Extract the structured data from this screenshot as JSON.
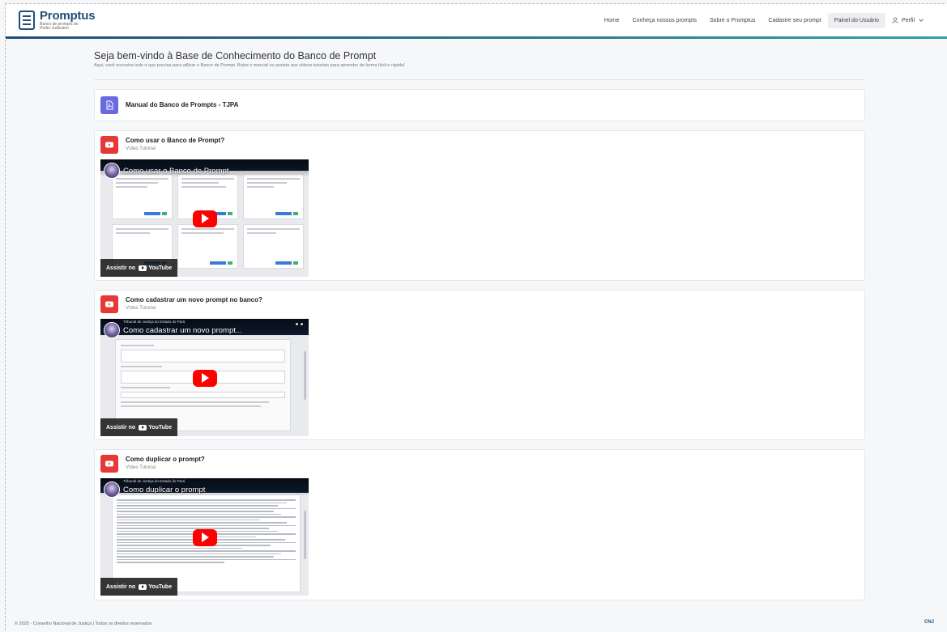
{
  "header": {
    "logo_title": "Promptus",
    "logo_sub": "Banco de prompts do Poder Judiciário",
    "nav": [
      {
        "label": "Home",
        "active": false
      },
      {
        "label": "Conheça nossos prompts",
        "active": false
      },
      {
        "label": "Sobre o Promptus",
        "active": false
      },
      {
        "label": "Cadastre seu prompt",
        "active": false
      },
      {
        "label": "Painel do Usuário",
        "active": true
      }
    ],
    "profile_label": "Perfil"
  },
  "main": {
    "title": "Seja bem-vindo à Base de Conhecimento do Banco de Prompt",
    "subtitle": "Aqui, você encontra tudo o que precisa para utilizar o Banco de Prompt. Baixe o manual ou assista aos vídeos tutoriais para aprender de forma fácil e rápida!"
  },
  "manual": {
    "title": "Manual do Banco de Prompts - TJPA",
    "icon": "pdf-icon"
  },
  "videos": [
    {
      "title": "Como usar o Banco de Prompt?",
      "subtitle": "Vídeo Tutorial",
      "video_title": "Como usar o Banco de Prompt",
      "channel": "",
      "watch_label": "Assistir no",
      "youtube_label": "YouTube"
    },
    {
      "title": "Como cadastrar um novo prompt no banco?",
      "subtitle": "Vídeo Tutorial",
      "video_title": "Como cadastrar um novo prompt...",
      "channel": "Tribunal de Justiça do Estado do Pará",
      "watch_label": "Assistir no",
      "youtube_label": "YouTube"
    },
    {
      "title": "Como duplicar o prompt?",
      "subtitle": "Vídeo Tutorial",
      "video_title": "Como duplicar o prompt",
      "channel": "Tribunal de Justiça do Estado do Pará",
      "watch_label": "Assistir no",
      "youtube_label": "YouTube"
    }
  ],
  "footer": {
    "copyright": "© 2025 · Conselho Nacional de Justiça | Todos os direitos reservados",
    "logos": "CNJ"
  },
  "colors": {
    "brand": "#1f4e79",
    "youtube_red": "#e53935",
    "pdf_purple": "#6b6be0"
  }
}
